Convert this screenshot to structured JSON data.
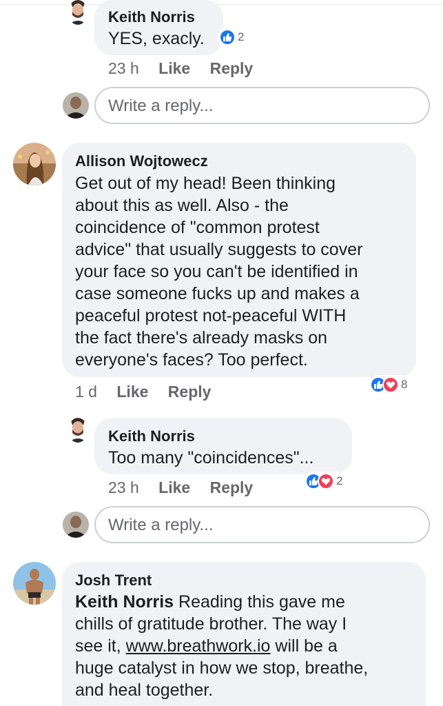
{
  "colors": {
    "like": "#1877f2",
    "love": "#f33e58",
    "bubble": "#f0f2f5",
    "meta": "#65676b"
  },
  "comments": [
    {
      "author": "Keith Norris",
      "lines": [
        "YES, exacly."
      ],
      "time": "23 h",
      "like": "Like",
      "reply": "Reply",
      "reactions": [
        "like-icon"
      ],
      "reaction_count": "2"
    },
    {
      "author": "Allison Wojtowecz",
      "lines": [
        "Get out of my head! Been thinking",
        "about this as well. Also - the",
        "coincidence of \"common protest",
        "advice\" that usually suggests to cover",
        "your face so you can't be identified in",
        "case someone fucks up and makes a",
        "peaceful protest not-peaceful WITH",
        "the fact there's already masks on",
        "everyone's faces? Too perfect."
      ],
      "time": "1 d",
      "like": "Like",
      "reply": "Reply",
      "reactions": [
        "like-icon",
        "heart-icon"
      ],
      "reaction_count": "8"
    },
    {
      "author": "Keith Norris",
      "lines": [
        "Too many \"coincidences\"..."
      ],
      "time": "23 h",
      "like": "Like",
      "reply": "Reply",
      "reactions": [
        "like-icon",
        "heart-icon"
      ],
      "reaction_count": "2"
    },
    {
      "author": "Josh Trent",
      "mention": "Keith Norris",
      "lines_after_mention": " Reading this gave me",
      "lines": [
        "chills of gratitude brother. The way I",
        "huge catalyst in how we stop, breathe,",
        "and heal together."
      ],
      "link_prefix": "see it, ",
      "link": "www.breathwork.io",
      "link_suffix": " will be a"
    }
  ],
  "reply_placeholder": "Write a reply..."
}
